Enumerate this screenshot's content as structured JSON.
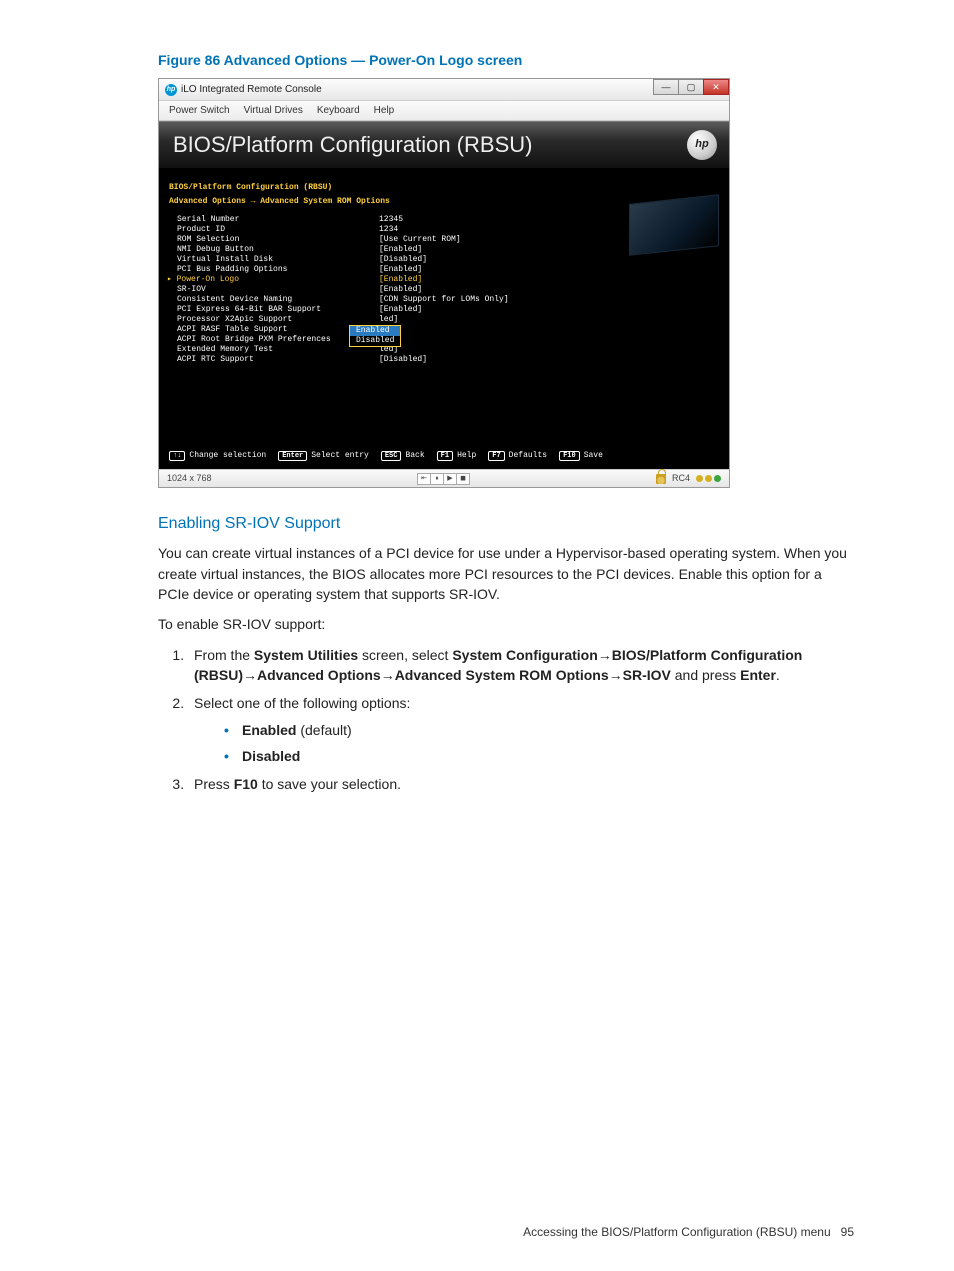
{
  "figure_caption": "Figure 86 Advanced Options — Power-On Logo screen",
  "window": {
    "title": "iLO Integrated Remote Console",
    "menu": [
      "Power Switch",
      "Virtual Drives",
      "Keyboard",
      "Help"
    ],
    "min": "—",
    "max": "▢",
    "close": "✕"
  },
  "bios": {
    "title": "BIOS/Platform Configuration (RBSU)",
    "logo": "hp",
    "heading": "BIOS/Platform Configuration (RBSU)",
    "breadcrumb": "Advanced Options → Advanced System ROM Options",
    "rows": [
      {
        "label": "Serial Number",
        "value": "12345",
        "selected": false
      },
      {
        "label": "Product ID",
        "value": "1234",
        "selected": false
      },
      {
        "label": "ROM Selection",
        "value": "[Use Current ROM]",
        "selected": false
      },
      {
        "label": "NMI Debug Button",
        "value": "[Enabled]",
        "selected": false
      },
      {
        "label": "Virtual Install Disk",
        "value": "[Disabled]",
        "selected": false
      },
      {
        "label": "PCI Bus Padding Options",
        "value": "[Enabled]",
        "selected": false
      },
      {
        "label": "Power-On Logo",
        "value": "[Enabled]",
        "selected": true
      },
      {
        "label": "SR-IOV",
        "value": "[Enabled]",
        "selected": false
      },
      {
        "label": "Consistent Device Naming",
        "value": "[CDN Support for LOMs Only]",
        "selected": false
      },
      {
        "label": "PCI Express 64-Bit BAR Support",
        "value": "[Enabled]",
        "selected": false
      },
      {
        "label": "Processor X2Apic Support",
        "value": "        led]",
        "selected": false
      },
      {
        "label": "ACPI RASF Table Support",
        "value": "        ed]",
        "selected": false
      },
      {
        "label": "ACPI Root Bridge PXM Preferences",
        "value": "        ed]",
        "selected": false
      },
      {
        "label": "Extended Memory Test",
        "value": "        led]",
        "selected": false
      },
      {
        "label": "ACPI RTC Support",
        "value": "[Disabled]",
        "selected": false
      }
    ],
    "popup": {
      "selected": "Enabled",
      "other": "Disabled"
    },
    "keys": [
      {
        "key": "↑↓",
        "label": "Change selection"
      },
      {
        "key": "Enter",
        "label": "Select entry"
      },
      {
        "key": "ESC",
        "label": "Back"
      },
      {
        "key": "F1",
        "label": "Help"
      },
      {
        "key": "F7",
        "label": "Defaults"
      },
      {
        "key": "F10",
        "label": "Save"
      }
    ]
  },
  "statusbar": {
    "resolution": "1024 x 768",
    "rc": "RC4"
  },
  "section_heading": "Enabling SR-IOV Support",
  "para1": "You can create virtual instances of a PCI device for use under a Hypervisor-based operating system. When you create virtual instances, the BIOS allocates more PCI resources to the PCI devices. Enable this option for a PCIe device or operating system that supports SR-IOV.",
  "para2": "To enable SR-IOV support:",
  "step1_a": "From the ",
  "step1_b": "System Utilities",
  "step1_c": " screen, select ",
  "step1_d": "System Configuration",
  "step1_e": "BIOS/Platform Configuration (RBSU)",
  "step1_f": "Advanced Options",
  "step1_g": "Advanced System ROM Options",
  "step1_h": "SR-IOV",
  "step1_i": " and press ",
  "step1_j": "Enter",
  "step1_k": ".",
  "step2": "Select one of the following options:",
  "opt1_a": "Enabled",
  "opt1_b": " (default)",
  "opt2": "Disabled",
  "step3_a": "Press ",
  "step3_b": "F10",
  "step3_c": " to save your selection.",
  "footer_text": "Accessing the BIOS/Platform Configuration (RBSU) menu",
  "page_num": "95",
  "arrow": "→"
}
